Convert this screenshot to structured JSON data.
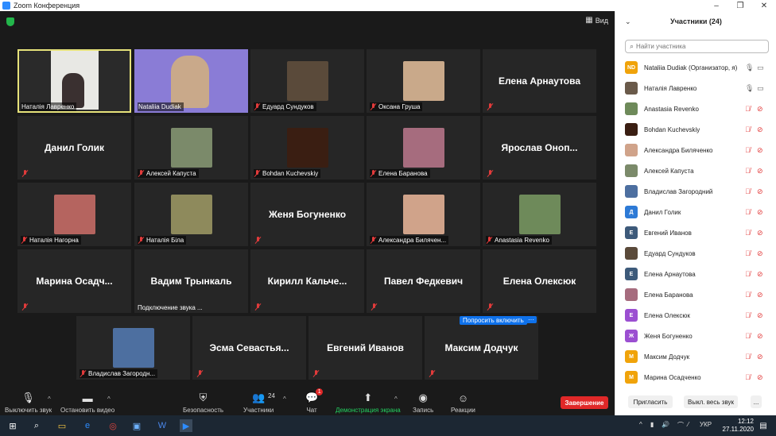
{
  "window": {
    "title": "Zoom Конференция",
    "minimize": "–",
    "restore": "❐",
    "close": "✕"
  },
  "view": {
    "label": "Вид"
  },
  "tiles": [
    {
      "id": "t1",
      "label": "Наталія Лавренко",
      "kind": "video",
      "active": true,
      "bg": "#2a2a2a"
    },
    {
      "id": "t2",
      "label": "Nataliia Dudiak",
      "kind": "video",
      "bg": "#8a7cd6"
    },
    {
      "id": "t3",
      "label": "Едуард Сундуков",
      "kind": "photo",
      "photo": "#5a4a3a"
    },
    {
      "id": "t4",
      "label": "Оксана Груша",
      "kind": "photo",
      "photo": "#c9a98a"
    },
    {
      "id": "t5",
      "name": "Елена Арнаутова",
      "kind": "name",
      "label": ""
    },
    {
      "id": "t6",
      "name": "Данил Голик",
      "kind": "name"
    },
    {
      "id": "t7",
      "label": "Алексей Капуста",
      "kind": "photo",
      "photo": "#7b8a6a"
    },
    {
      "id": "t8",
      "label": "Bohdan Kuchevskiy",
      "kind": "photo",
      "photo": "#3a1e12"
    },
    {
      "id": "t9",
      "label": "Елена Баранова",
      "kind": "photo",
      "photo": "#a66c7e"
    },
    {
      "id": "t10",
      "name": "Ярослав Оноприенко",
      "kind": "name"
    },
    {
      "id": "t11",
      "label": "Наталія Нагорна",
      "kind": "photo",
      "photo": "#b5645f"
    },
    {
      "id": "t12",
      "label": "Наталія Біла",
      "kind": "photo",
      "photo": "#8e8a5c"
    },
    {
      "id": "t13",
      "name": "Женя Богуненко",
      "kind": "name"
    },
    {
      "id": "t14",
      "label": "Александра Биляченко",
      "kind": "photo",
      "photo": "#d0a38a"
    },
    {
      "id": "t15",
      "label": "Anastasia Revenko",
      "kind": "photo",
      "photo": "#6e8a5a"
    },
    {
      "id": "t16",
      "name": "Марина Осадченко",
      "kind": "name"
    },
    {
      "id": "t17",
      "name": "Вадим Трынкаль",
      "kind": "name",
      "connecting": "Подключение звука ..."
    },
    {
      "id": "t18",
      "name": "Кирилл Кальченко",
      "kind": "name"
    },
    {
      "id": "t19",
      "name": "Павел Федкевич",
      "kind": "name"
    },
    {
      "id": "t20",
      "name": "Елена Олексюк",
      "kind": "name"
    },
    {
      "id": "t21",
      "label": "Владислав Загородний",
      "kind": "photo",
      "photo": "#4d6fa0"
    },
    {
      "id": "t22",
      "name": "Эсма Севастьянова",
      "kind": "name"
    },
    {
      "id": "t23",
      "name": "Евгений Иванов",
      "kind": "name"
    },
    {
      "id": "t24",
      "name": "Максим Додчук",
      "kind": "name"
    }
  ],
  "tile_display": {
    "t10": "Ярослав  Оноп...",
    "t16": "Марина  Осадч...",
    "t18": "Кирилл  Кальче...",
    "t22": "Эсма  Севастья...",
    "t14": "Александра Билячен...",
    "t21": "Владислав Загородн..."
  },
  "ask_unmute": {
    "label": "Попросить включить",
    "more": "···"
  },
  "toolbar": {
    "mute": "Выключить звук",
    "video": "Остановить видео",
    "security": "Безопасность",
    "participants": "Участники",
    "participants_count": "24",
    "chat": "Чат",
    "chat_badge": "1",
    "share": "Демонстрация экрана",
    "record": "Запись",
    "reactions": "Реакции",
    "end": "Завершение"
  },
  "panel": {
    "title": "Участники (24)",
    "search_placeholder": "Найти участника",
    "invite": "Пригласить",
    "mute_all": "Выкл. весь звук",
    "more": "...",
    "participants": [
      {
        "name": "Nataliia Dudiak (Организатор, я)",
        "initials": "ND",
        "color": "#f0a30a",
        "mic": "on",
        "video": "on"
      },
      {
        "name": "Наталія Лавренко",
        "initials": "",
        "color": "#6a5a4a",
        "mic": "on",
        "video": "on"
      },
      {
        "name": "Anastasia Revenko",
        "initials": "",
        "color": "#6e8a5a",
        "mic": "off",
        "video": "off"
      },
      {
        "name": "Bohdan Kuchevskiy",
        "initials": "",
        "color": "#3a1e12",
        "mic": "off",
        "video": "off"
      },
      {
        "name": "Александра Биляченко",
        "initials": "",
        "color": "#d0a38a",
        "mic": "off",
        "video": "off"
      },
      {
        "name": "Алексей Капуста",
        "initials": "",
        "color": "#7b8a6a",
        "mic": "off",
        "video": "off"
      },
      {
        "name": "Владислав Загородний",
        "initials": "",
        "color": "#4d6fa0",
        "mic": "off",
        "video": "off"
      },
      {
        "name": "Данил Голик",
        "initials": "Д",
        "color": "#2d7ad6",
        "mic": "off",
        "video": "off"
      },
      {
        "name": "Евгений Иванов",
        "initials": "Е",
        "color": "#3d5a7a",
        "mic": "off",
        "video": "off"
      },
      {
        "name": "Едуард Сундуков",
        "initials": "",
        "color": "#5a4a3a",
        "mic": "off",
        "video": "off"
      },
      {
        "name": "Елена Арнаутова",
        "initials": "Е",
        "color": "#3d5a7a",
        "mic": "off",
        "video": "off"
      },
      {
        "name": "Елена Баранова",
        "initials": "",
        "color": "#a66c7e",
        "mic": "off",
        "video": "off"
      },
      {
        "name": "Елена Олексюк",
        "initials": "Е",
        "color": "#9b4fd1",
        "mic": "off",
        "video": "off"
      },
      {
        "name": "Женя Богуненко",
        "initials": "Ж",
        "color": "#9b4fd1",
        "mic": "off",
        "video": "off"
      },
      {
        "name": "Максим Додчук",
        "initials": "М",
        "color": "#f0a30a",
        "mic": "off",
        "video": "off"
      },
      {
        "name": "Марина Осадченко",
        "initials": "М",
        "color": "#f0a30a",
        "mic": "off",
        "video": "off"
      }
    ]
  },
  "taskbar": {
    "lang": "УКР",
    "time": "12:12",
    "date": "27.11.2020"
  }
}
